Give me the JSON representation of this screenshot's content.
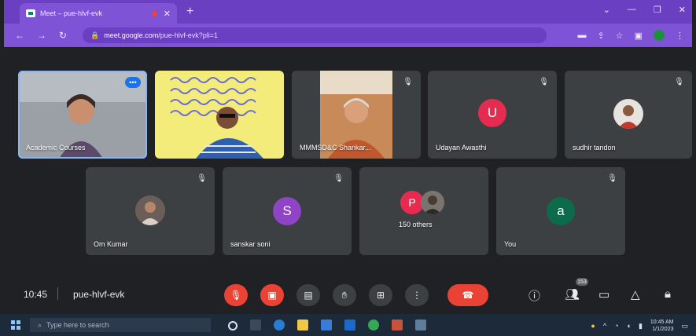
{
  "browser": {
    "tab_title": "Meet – pue-hlvf-evk",
    "new_tab_label": "+",
    "tab_close": "✕",
    "url_host": "meet.google.com",
    "url_path": "/pue-hlvf-evk?pli=1",
    "window_controls": [
      "⌄",
      "—",
      "❐",
      "✕"
    ]
  },
  "meet": {
    "top_tiles": [
      {
        "name": "Academic Courses",
        "kind": "video",
        "speaking": true
      },
      {
        "name": "",
        "kind": "video"
      },
      {
        "name": "MMMSD&C Shankar...",
        "kind": "video"
      },
      {
        "name": "Udayan Awasthi",
        "kind": "letter",
        "letter": "U",
        "color": "#e52b50"
      },
      {
        "name": "sudhir tandon",
        "kind": "photo"
      }
    ],
    "bottom_tiles": [
      {
        "name": "Om Kumar",
        "kind": "photo"
      },
      {
        "name": "sanskar soni",
        "kind": "letter",
        "letter": "S",
        "color": "#8e44c4"
      },
      {
        "name": "150 others",
        "kind": "others",
        "letter": "P",
        "color": "#e52b50"
      },
      {
        "name": "You",
        "kind": "letter",
        "letter": "a",
        "color": "#0b6b4a"
      }
    ],
    "time": "10:45",
    "code": "pue-hlvf-evk",
    "people_badge": "153"
  },
  "taskbar": {
    "search_placeholder": "Type here to search",
    "time": "10:45 AM",
    "date": "1/1/2023"
  }
}
